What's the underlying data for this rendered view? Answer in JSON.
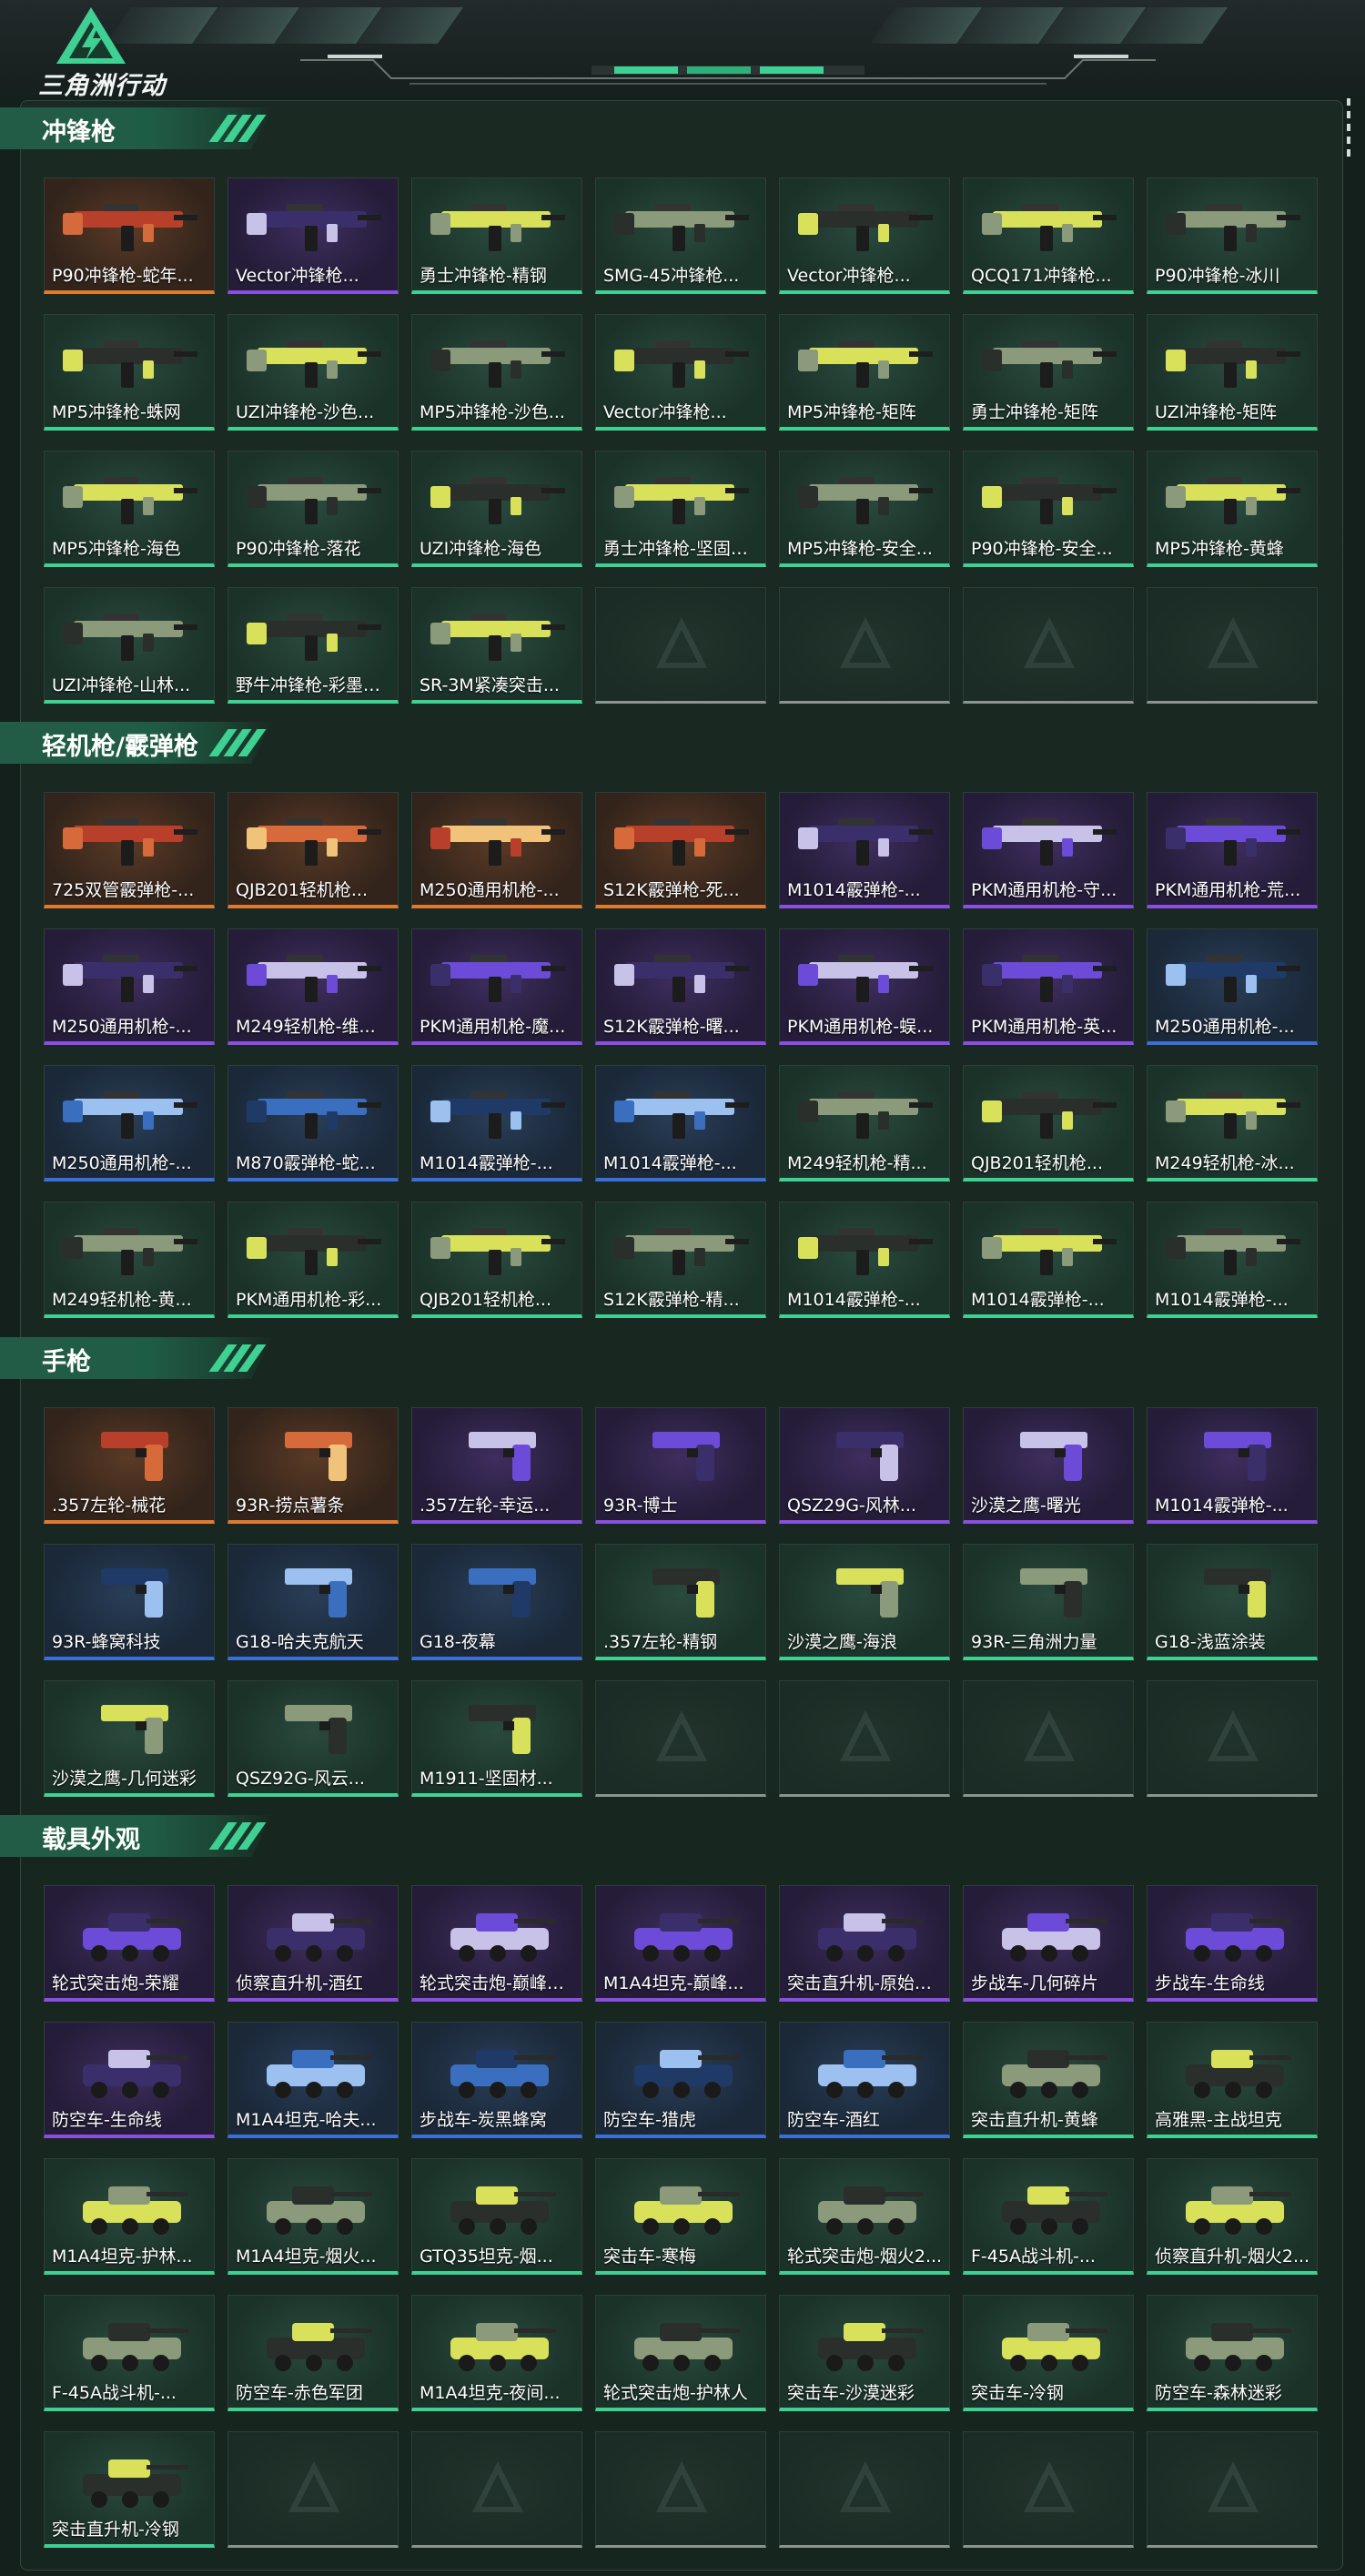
{
  "header": {
    "logo_text": "三角洲行动"
  },
  "colors": {
    "accent": "#3ed193",
    "rarity_green": "#3ed193",
    "rarity_blue": "#3b6fd8",
    "rarity_purple": "#8a4ee0",
    "rarity_orange": "#e07a2f",
    "empty": "#8a9590"
  },
  "sections": [
    {
      "title": "冲锋枪",
      "icon": "weapon",
      "items": [
        {
          "label": "P90冲锋枪-蛇年...",
          "rarity": "orange"
        },
        {
          "label": "Vector冲锋枪...",
          "rarity": "purple"
        },
        {
          "label": "勇士冲锋枪-精钢",
          "rarity": "green"
        },
        {
          "label": "SMG-45冲锋枪...",
          "rarity": "green"
        },
        {
          "label": "Vector冲锋枪...",
          "rarity": "green"
        },
        {
          "label": "QCQ171冲锋枪...",
          "rarity": "green"
        },
        {
          "label": "P90冲锋枪-冰川",
          "rarity": "green"
        },
        {
          "label": "MP5冲锋枪-蛛网",
          "rarity": "green"
        },
        {
          "label": "UZI冲锋枪-沙色...",
          "rarity": "green"
        },
        {
          "label": "MP5冲锋枪-沙色...",
          "rarity": "green"
        },
        {
          "label": "Vector冲锋枪...",
          "rarity": "green"
        },
        {
          "label": "MP5冲锋枪-矩阵",
          "rarity": "green"
        },
        {
          "label": "勇士冲锋枪-矩阵",
          "rarity": "green"
        },
        {
          "label": "UZI冲锋枪-矩阵",
          "rarity": "green"
        },
        {
          "label": "MP5冲锋枪-海色",
          "rarity": "green"
        },
        {
          "label": "P90冲锋枪-落花",
          "rarity": "green"
        },
        {
          "label": "UZI冲锋枪-海色",
          "rarity": "green"
        },
        {
          "label": "勇士冲锋枪-坚固材...",
          "rarity": "green"
        },
        {
          "label": "MP5冲锋枪-安全...",
          "rarity": "green"
        },
        {
          "label": "P90冲锋枪-安全...",
          "rarity": "green"
        },
        {
          "label": "MP5冲锋枪-黄蜂",
          "rarity": "green"
        },
        {
          "label": "UZI冲锋枪-山林...",
          "rarity": "green"
        },
        {
          "label": "野牛冲锋枪-彩墨喷...",
          "rarity": "green"
        },
        {
          "label": "SR-3M紧凑突击...",
          "rarity": "green"
        },
        {
          "label": "",
          "rarity": "empty"
        },
        {
          "label": "",
          "rarity": "empty"
        },
        {
          "label": "",
          "rarity": "empty"
        },
        {
          "label": "",
          "rarity": "empty"
        }
      ]
    },
    {
      "title": "轻机枪/霰弹枪",
      "icon": "weapon",
      "items": [
        {
          "label": "725双管霰弹枪-...",
          "rarity": "orange"
        },
        {
          "label": "QJB201轻机枪...",
          "rarity": "orange"
        },
        {
          "label": "M250通用机枪-...",
          "rarity": "orange"
        },
        {
          "label": "S12K霰弹枪-死...",
          "rarity": "orange"
        },
        {
          "label": "M1014霰弹枪-...",
          "rarity": "purple"
        },
        {
          "label": "PKM通用机枪-守...",
          "rarity": "purple"
        },
        {
          "label": "PKM通用机枪-荒...",
          "rarity": "purple"
        },
        {
          "label": "M250通用机枪-...",
          "rarity": "purple"
        },
        {
          "label": "M249轻机枪-维...",
          "rarity": "purple"
        },
        {
          "label": "PKM通用机枪-魔...",
          "rarity": "purple"
        },
        {
          "label": "S12K霰弹枪-曙...",
          "rarity": "purple"
        },
        {
          "label": "PKM通用机枪-蜈...",
          "rarity": "purple"
        },
        {
          "label": "PKM通用机枪-英...",
          "rarity": "purple"
        },
        {
          "label": "M250通用机枪-...",
          "rarity": "blue"
        },
        {
          "label": "M250通用机枪-...",
          "rarity": "blue"
        },
        {
          "label": "M870霰弹枪-蛇...",
          "rarity": "blue"
        },
        {
          "label": "M1014霰弹枪-...",
          "rarity": "blue"
        },
        {
          "label": "M1014霰弹枪-...",
          "rarity": "blue"
        },
        {
          "label": "M249轻机枪-精...",
          "rarity": "green"
        },
        {
          "label": "QJB201轻机枪...",
          "rarity": "green"
        },
        {
          "label": "M249轻机枪-冰...",
          "rarity": "green"
        },
        {
          "label": "M249轻机枪-黄...",
          "rarity": "green"
        },
        {
          "label": "PKM通用机枪-彩...",
          "rarity": "green"
        },
        {
          "label": "QJB201轻机枪...",
          "rarity": "green"
        },
        {
          "label": "S12K霰弹枪-精...",
          "rarity": "green"
        },
        {
          "label": "M1014霰弹枪-...",
          "rarity": "green"
        },
        {
          "label": "M1014霰弹枪-...",
          "rarity": "green"
        },
        {
          "label": "M1014霰弹枪-...",
          "rarity": "green"
        }
      ]
    },
    {
      "title": "手枪",
      "icon": "pistol",
      "items": [
        {
          "label": ".357左轮-械花",
          "rarity": "orange"
        },
        {
          "label": "93R-捞点薯条",
          "rarity": "orange"
        },
        {
          "label": ".357左轮-幸运...",
          "rarity": "purple"
        },
        {
          "label": "93R-博士",
          "rarity": "purple"
        },
        {
          "label": "QSZ29G-风林...",
          "rarity": "purple"
        },
        {
          "label": "沙漠之鹰-曙光",
          "rarity": "purple"
        },
        {
          "label": "M1014霰弹枪-...",
          "rarity": "purple"
        },
        {
          "label": "93R-蜂窝科技",
          "rarity": "blue"
        },
        {
          "label": "G18-哈夫克航天",
          "rarity": "blue"
        },
        {
          "label": "G18-夜幕",
          "rarity": "blue"
        },
        {
          "label": ".357左轮-精钢",
          "rarity": "green"
        },
        {
          "label": "沙漠之鹰-海浪",
          "rarity": "green"
        },
        {
          "label": "93R-三角洲力量",
          "rarity": "green"
        },
        {
          "label": "G18-浅蓝涂装",
          "rarity": "green"
        },
        {
          "label": "沙漠之鹰-几何迷彩",
          "rarity": "green"
        },
        {
          "label": "QSZ92G-风云...",
          "rarity": "green"
        },
        {
          "label": "M1911-坚固材...",
          "rarity": "green"
        },
        {
          "label": "",
          "rarity": "empty"
        },
        {
          "label": "",
          "rarity": "empty"
        },
        {
          "label": "",
          "rarity": "empty"
        },
        {
          "label": "",
          "rarity": "empty"
        }
      ]
    },
    {
      "title": "载具外观",
      "icon": "vehicle",
      "items": [
        {
          "label": "轮式突击炮-荣耀",
          "rarity": "purple"
        },
        {
          "label": "侦察直升机-酒红",
          "rarity": "purple"
        },
        {
          "label": "轮式突击炮-巅峰竞...",
          "rarity": "purple"
        },
        {
          "label": "M1A4坦克-巅峰...",
          "rarity": "purple"
        },
        {
          "label": "突击直升机-原始伪...",
          "rarity": "purple"
        },
        {
          "label": "步战车-几何碎片",
          "rarity": "purple"
        },
        {
          "label": "步战车-生命线",
          "rarity": "purple"
        },
        {
          "label": "防空车-生命线",
          "rarity": "purple"
        },
        {
          "label": "M1A4坦克-哈夫...",
          "rarity": "blue"
        },
        {
          "label": "步战车-炭黑蜂窝",
          "rarity": "blue"
        },
        {
          "label": "防空车-猎虎",
          "rarity": "blue"
        },
        {
          "label": "防空车-酒红",
          "rarity": "blue"
        },
        {
          "label": "突击直升机-黄蜂",
          "rarity": "green"
        },
        {
          "label": "高雅黑-主战坦克",
          "rarity": "green"
        },
        {
          "label": "M1A4坦克-护林...",
          "rarity": "green"
        },
        {
          "label": "M1A4坦克-烟火...",
          "rarity": "green"
        },
        {
          "label": "GTQ35坦克-烟...",
          "rarity": "green"
        },
        {
          "label": "突击车-寒梅",
          "rarity": "green"
        },
        {
          "label": "轮式突击炮-烟火2...",
          "rarity": "green"
        },
        {
          "label": "F-45A战斗机-...",
          "rarity": "green"
        },
        {
          "label": "侦察直升机-烟火2...",
          "rarity": "green"
        },
        {
          "label": "F-45A战斗机-...",
          "rarity": "green"
        },
        {
          "label": "防空车-赤色军团",
          "rarity": "green"
        },
        {
          "label": "M1A4坦克-夜间...",
          "rarity": "green"
        },
        {
          "label": "轮式突击炮-护林人",
          "rarity": "green"
        },
        {
          "label": "突击车-沙漠迷彩",
          "rarity": "green"
        },
        {
          "label": "突击车-冷钢",
          "rarity": "green"
        },
        {
          "label": "防空车-森林迷彩",
          "rarity": "green"
        },
        {
          "label": "突击直升机-冷钢",
          "rarity": "green"
        },
        {
          "label": "",
          "rarity": "empty"
        },
        {
          "label": "",
          "rarity": "empty"
        },
        {
          "label": "",
          "rarity": "empty"
        },
        {
          "label": "",
          "rarity": "empty"
        },
        {
          "label": "",
          "rarity": "empty"
        },
        {
          "label": "",
          "rarity": "empty"
        }
      ]
    }
  ]
}
